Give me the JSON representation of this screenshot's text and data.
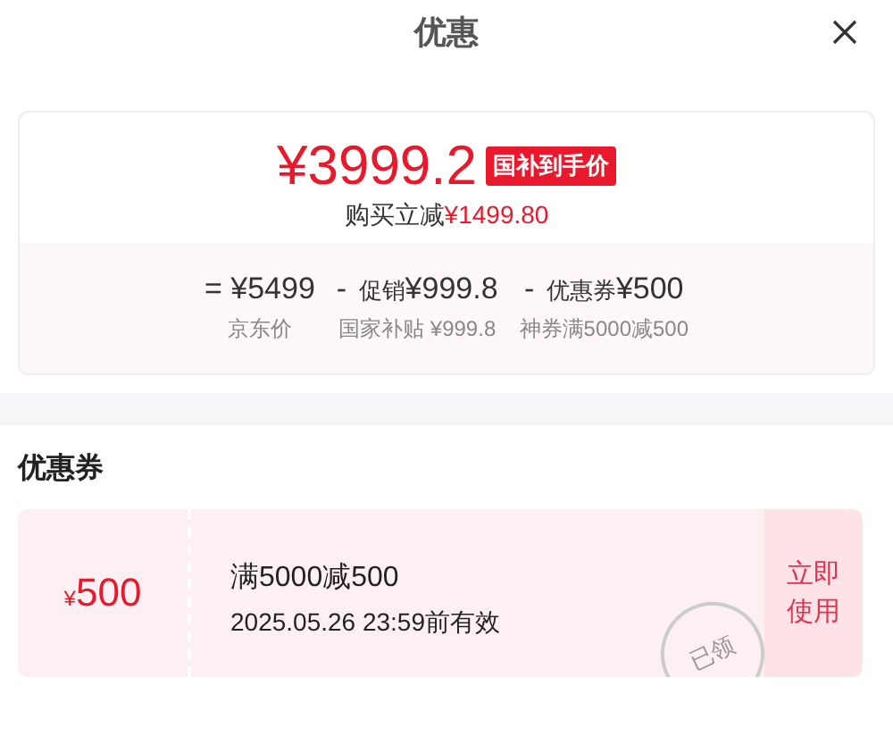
{
  "header": {
    "title": "优惠"
  },
  "summary": {
    "price": "¥3999.2",
    "badge": "国补到手价",
    "savings": {
      "label": "购买立减",
      "amount": "¥1499.80"
    },
    "breakdown": [
      {
        "operator": "=",
        "amount": "¥5499",
        "caption": "京东价"
      },
      {
        "operator": "-",
        "label": "促销",
        "amount": "¥999.8",
        "caption": "国家补贴 ¥999.8"
      },
      {
        "operator": "-",
        "label": "优惠券",
        "amount": "¥500",
        "caption": "神券满5000减500"
      }
    ]
  },
  "coupons_section": {
    "title": "优惠券",
    "coupons": [
      {
        "currency": "¥",
        "value": "500",
        "condition": "满5000减500",
        "validity": "2025.05.26 23:59前有效",
        "stamp": "已领",
        "action": "立即使用"
      }
    ]
  }
}
